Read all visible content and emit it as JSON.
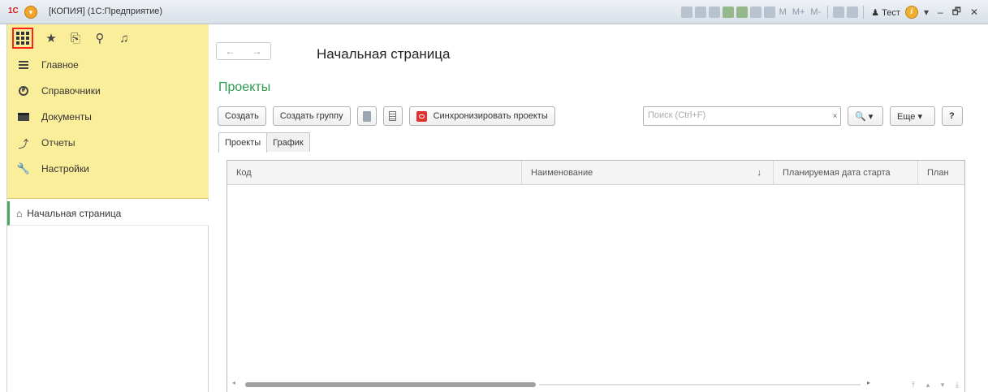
{
  "window": {
    "logo": "1С",
    "title": "[КОПИЯ]  (1С:Предприятие)",
    "toolbar_text": [
      "M",
      "M+",
      "M-"
    ],
    "user": "Тест",
    "info": "i",
    "controls": [
      "–",
      "🗗",
      "✕"
    ]
  },
  "sidebar": {
    "top_icons": [
      "star-icon",
      "history-icon",
      "search-icon",
      "bell-icon"
    ],
    "sections": [
      {
        "label": "Главное",
        "icon": "lines-icon"
      },
      {
        "label": "Справочники",
        "icon": "catalog-icon"
      },
      {
        "label": "Документы",
        "icon": "table-icon"
      },
      {
        "label": "Отчеты",
        "icon": "chart-icon"
      },
      {
        "label": "Настройки",
        "icon": "wrench-icon"
      }
    ],
    "open_windows": [
      {
        "label": "Начальная страница",
        "icon": "home-icon"
      }
    ]
  },
  "page": {
    "title": "Начальная страница",
    "nav_back": "←",
    "nav_forward": "→"
  },
  "form": {
    "title": "Проекты",
    "buttons": {
      "create": "Создать",
      "create_group": "Создать группу",
      "sync": "Синхронизировать проекты",
      "more": "Еще ▾",
      "help": "?",
      "find": "🔍 ▾"
    },
    "search": {
      "placeholder": "Поиск (Ctrl+F)",
      "clear": "×"
    },
    "tabs": [
      "Проекты",
      "График"
    ],
    "active_tab": "Проекты",
    "table": {
      "columns": [
        "Код",
        "Наименование",
        "Планируемая дата старта",
        "План"
      ],
      "sort_indicator": "↓",
      "rows": []
    }
  }
}
